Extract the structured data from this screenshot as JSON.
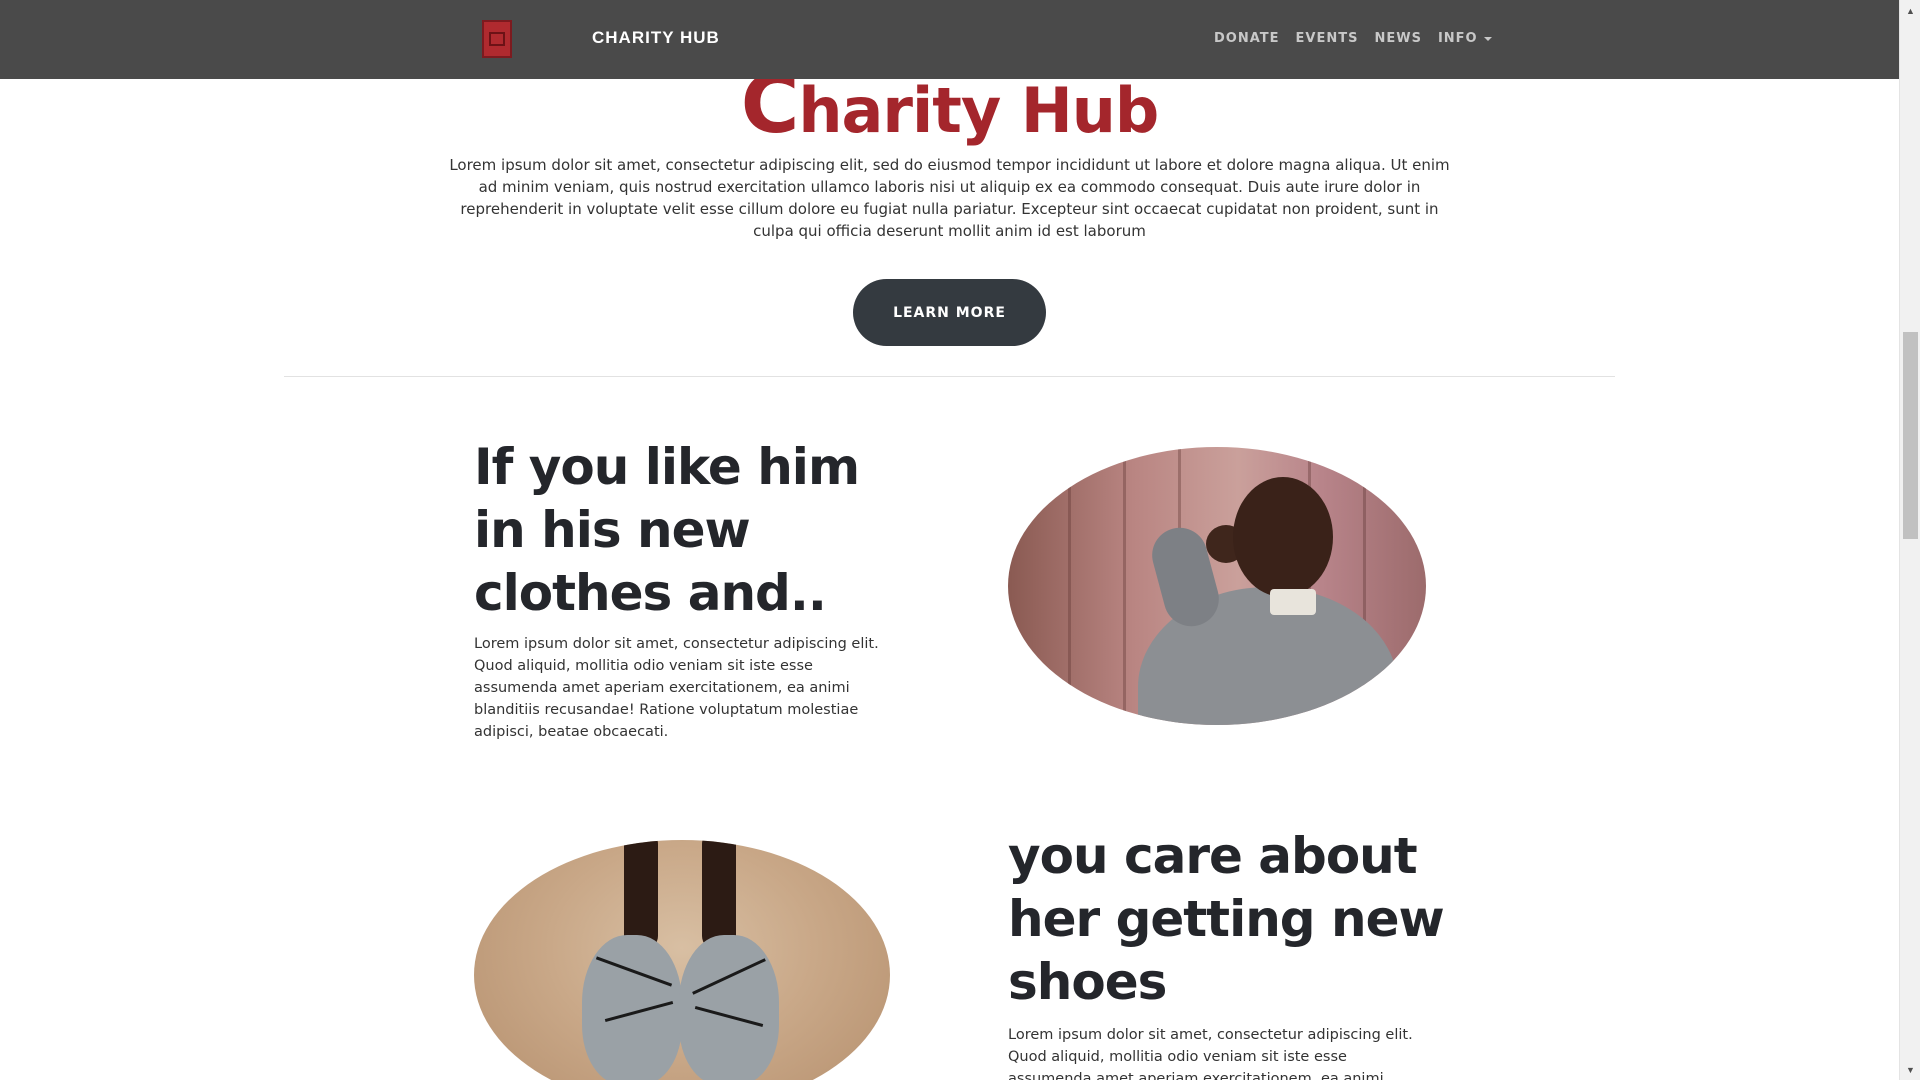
{
  "navbar": {
    "brand": "CHARITY HUB",
    "links": [
      "DONATE",
      "EVENTS",
      "NEWS",
      "INFO"
    ]
  },
  "hero": {
    "title_first": "C",
    "title_rest": "harity Hub",
    "text": "Lorem ipsum dolor sit amet, consectetur adipiscing elit, sed do eiusmod tempor incididunt ut labore et dolore magna aliqua. Ut enim ad minim veniam, quis nostrud exercitation ullamco laboris nisi ut aliquip ex ea commodo consequat. Duis aute irure dolor in reprehenderit in voluptate velit esse cillum dolore eu fugiat nulla pariatur. Excepteur sint occaecat cupidatat non proident, sunt in culpa qui officia deserunt mollit anim id est laborum",
    "button": "LEARN MORE"
  },
  "sections": [
    {
      "heading": "If you like him in his new clothes and..",
      "text": "Lorem ipsum dolor sit amet, consectetur adipiscing elit. Quod aliquid, mollitia odio veniam sit iste esse assumenda amet aperiam exercitationem, ea animi blanditiis recusandae! Ratione voluptatum molestiae adipisci, beatae obcaecati."
    },
    {
      "heading": "you care about her getting new shoes",
      "text": "Lorem ipsum dolor sit amet, consectetur adipiscing elit. Quod aliquid, mollitia odio veniam sit iste esse assumenda amet aperiam exercitationem, ea animi blanditiis recusandae!"
    }
  ],
  "colors": {
    "navbar": "#4a4a4a",
    "brand_red": "#a4262c",
    "button": "#343a40"
  },
  "icons": {
    "logo": "charity-logo-icon",
    "dropdown": "caret-down-icon"
  }
}
